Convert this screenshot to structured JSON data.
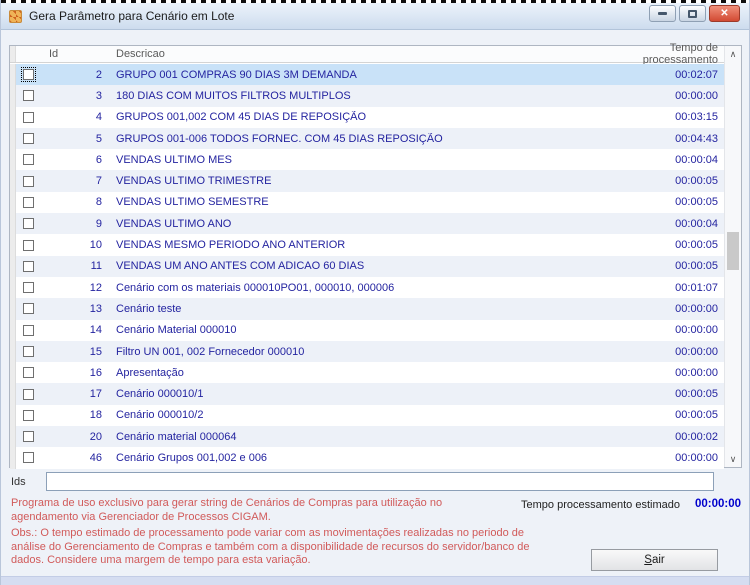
{
  "window": {
    "title": "Gera Parâmetro para Cenário em Lote",
    "close_glyph": "✕",
    "controls": [
      "minimize-icon",
      "maximize-icon",
      "close-icon"
    ]
  },
  "table": {
    "columns": [
      "Id",
      "Descricao",
      "Tempo de processamento"
    ],
    "rows": [
      {
        "id": "2",
        "desc": "GRUPO 001 COMPRAS 90 DIAS 3M DEMANDA",
        "time": "00:02:07",
        "selected": true,
        "checked": false
      },
      {
        "id": "3",
        "desc": "180 DIAS COM MUITOS FILTROS MULTIPLOS",
        "time": "00:00:00",
        "selected": false,
        "checked": false
      },
      {
        "id": "4",
        "desc": "GRUPOS 001,002 COM 45 DIAS DE REPOSIÇÃO",
        "time": "00:03:15",
        "selected": false,
        "checked": false
      },
      {
        "id": "5",
        "desc": "GRUPOS 001-006 TODOS FORNEC. COM 45 DIAS REPOSIÇÃO",
        "time": "00:04:43",
        "selected": false,
        "checked": false
      },
      {
        "id": "6",
        "desc": "VENDAS ULTIMO MES",
        "time": "00:00:04",
        "selected": false,
        "checked": false
      },
      {
        "id": "7",
        "desc": "VENDAS ULTIMO TRIMESTRE",
        "time": "00:00:05",
        "selected": false,
        "checked": false
      },
      {
        "id": "8",
        "desc": "VENDAS ULTIMO SEMESTRE",
        "time": "00:00:05",
        "selected": false,
        "checked": false
      },
      {
        "id": "9",
        "desc": "VENDAS ULTIMO ANO",
        "time": "00:00:04",
        "selected": false,
        "checked": false
      },
      {
        "id": "10",
        "desc": "VENDAS MESMO PERIODO ANO ANTERIOR",
        "time": "00:00:05",
        "selected": false,
        "checked": false
      },
      {
        "id": "11",
        "desc": "VENDAS UM ANO ANTES COM ADICAO 60 DIAS",
        "time": "00:00:05",
        "selected": false,
        "checked": false
      },
      {
        "id": "12",
        "desc": "Cenário com os materiais 000010PO01, 000010, 000006",
        "time": "00:01:07",
        "selected": false,
        "checked": false
      },
      {
        "id": "13",
        "desc": "Cenário teste",
        "time": "00:00:00",
        "selected": false,
        "checked": false
      },
      {
        "id": "14",
        "desc": "Cenário Material 000010",
        "time": "00:00:00",
        "selected": false,
        "checked": false
      },
      {
        "id": "15",
        "desc": "Filtro UN 001, 002 Fornecedor 000010",
        "time": "00:00:00",
        "selected": false,
        "checked": false
      },
      {
        "id": "16",
        "desc": "Apresentação",
        "time": "00:00:00",
        "selected": false,
        "checked": false
      },
      {
        "id": "17",
        "desc": "Cenário 000010/1",
        "time": "00:00:05",
        "selected": false,
        "checked": false
      },
      {
        "id": "18",
        "desc": "Cenário 000010/2",
        "time": "00:00:05",
        "selected": false,
        "checked": false
      },
      {
        "id": "20",
        "desc": "Cenário material 000064",
        "time": "00:00:02",
        "selected": false,
        "checked": false
      },
      {
        "id": "46",
        "desc": "Cenário Grupos 001,002 e 006",
        "time": "00:00:00",
        "selected": false,
        "checked": false
      }
    ]
  },
  "footer": {
    "ids_label": "Ids",
    "ids_value": "",
    "notice1": "Programa de uso exclusivo para gerar string de Cenários de Compras para utilização no agendamento via Gerenciador de Processos CIGAM.",
    "estimated_label": "Tempo processamento estimado",
    "estimated_value": "00:00:00",
    "notice2": "Obs.: O tempo estimado de processamento pode variar com as movimentações realizadas no periodo de análise do Gerenciamento de Compras e também com a disponibilidade de recursos do servidor/banco de dados. Considere uma margem de tempo para esta variação.",
    "exit_accel": "S",
    "exit_rest": "air"
  },
  "colors": {
    "row_text": "#2424a0",
    "selected_row_bg": "#c9e2f8",
    "alt_row_bg": "#edf1f8",
    "notice_red": "#d15a5a",
    "estimated_value_blue": "#0000cc",
    "titlebar_gradient_top": "#ecf3fb",
    "titlebar_gradient_bottom": "#cddcee",
    "close_button": "#d24a33"
  }
}
